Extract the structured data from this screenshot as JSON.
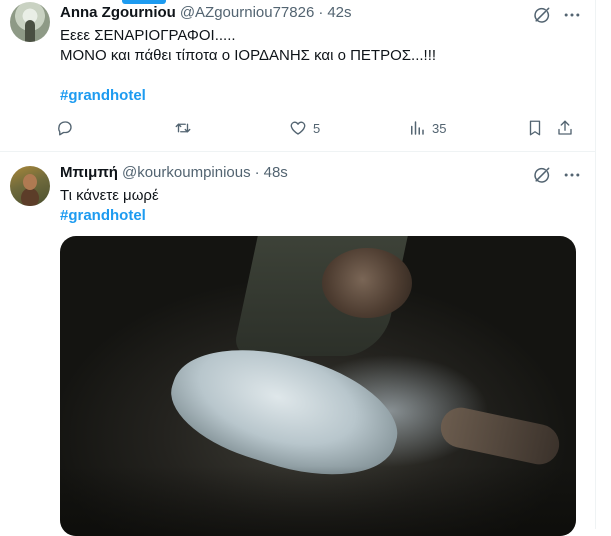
{
  "tweets": [
    {
      "name": "Anna Zgourniou",
      "handle": "@AZgourniou77826",
      "dot": "·",
      "time": "42s",
      "text_lines": [
        "Εεεε ΣΕΝΑΡΙΟΓΡΑΦΟΙ.....",
        "ΜΟΝΟ και πάθει τίποτα ο ΙΟΡΔΑΝΗΣ και ο ΠΕΤΡΟΣ...!!!"
      ],
      "hashtag": "#grandhotel",
      "actions": {
        "likes": "5",
        "views": "35"
      }
    },
    {
      "name": "Μπιμπή",
      "handle": "@kourkoumpinious",
      "dot": "·",
      "time": "48s",
      "text_lines": [
        "Τι κάνετε μωρέ"
      ],
      "hashtag": "#grandhotel"
    }
  ],
  "icons": {
    "grok": "grok-slash-circle-icon",
    "more": "more-horizontal-icon",
    "reply": "reply-bubble-icon",
    "retweet": "retweet-icon",
    "like": "heart-icon",
    "views": "views-bar-chart-icon",
    "bookmark": "bookmark-icon",
    "share": "share-upload-icon"
  },
  "colors": {
    "accent": "#1d9bf0",
    "text": "#0f1419",
    "secondary": "#536471",
    "border": "#eff3f4"
  }
}
